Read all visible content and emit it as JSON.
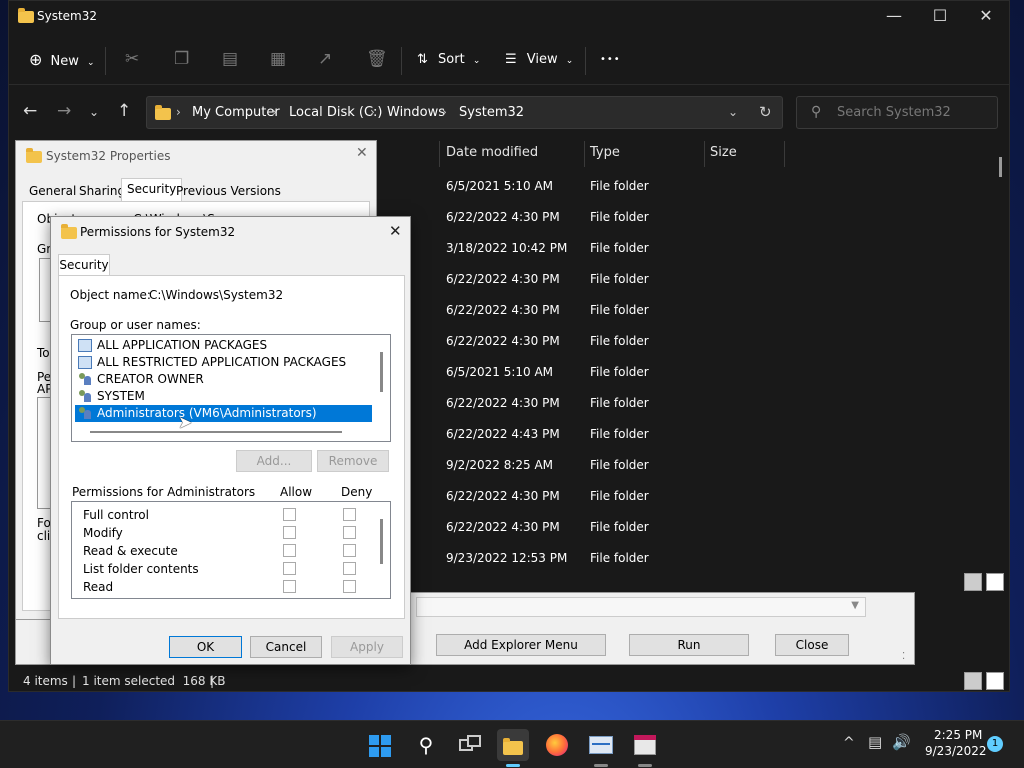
{
  "explorer": {
    "title": "System32",
    "toolbar": {
      "new_label": "New",
      "sort_label": "Sort",
      "view_label": "View",
      "more_label": "•••"
    },
    "breadcrumb": [
      "My Computer",
      "Local Disk (C:)",
      "Windows",
      "System32"
    ],
    "search_placeholder": "Search System32",
    "columns": {
      "date_modified": "Date modified",
      "type": "Type",
      "size": "Size"
    },
    "rows": [
      {
        "date": "6/5/2021 5:10 AM",
        "type": "File folder"
      },
      {
        "date": "6/22/2022 4:30 PM",
        "type": "File folder"
      },
      {
        "date": "3/18/2022 10:42 PM",
        "type": "File folder"
      },
      {
        "date": "6/22/2022 4:30 PM",
        "type": "File folder"
      },
      {
        "date": "6/22/2022 4:30 PM",
        "type": "File folder"
      },
      {
        "date": "6/22/2022 4:30 PM",
        "type": "File folder"
      },
      {
        "date": "6/5/2021 5:10 AM",
        "type": "File folder"
      },
      {
        "date": "6/22/2022 4:30 PM",
        "type": "File folder"
      },
      {
        "date": "6/22/2022 4:43 PM",
        "type": "File folder"
      },
      {
        "date": "9/2/2022 8:25 AM",
        "type": "File folder"
      },
      {
        "date": "6/22/2022 4:30 PM",
        "type": "File folder"
      },
      {
        "date": "6/22/2022 4:30 PM",
        "type": "File folder"
      },
      {
        "date": "9/23/2022 12:53 PM",
        "type": "File folder"
      }
    ],
    "status": {
      "items": "4 items",
      "selected": "1 item selected  168 KB",
      "sep": "|"
    }
  },
  "run_dialog": {
    "add_menu_label": "Add Explorer Menu",
    "run_label": "Run",
    "close_label": "Close"
  },
  "properties": {
    "title": "System32 Properties",
    "tabs": [
      "General",
      "Sharing",
      "Security",
      "Previous Versions"
    ],
    "frag_object": "Object name:    C:\\Windows\\System32",
    "frag_gro": "Gro",
    "frag_to": "To",
    "frag_pe": "Pe",
    "frag_ap": "AP",
    "frag_for": "For",
    "frag_cli": "clic"
  },
  "permissions": {
    "title": "Permissions for System32",
    "tab": "Security",
    "object_label": "Object name:",
    "object_value": "C:\\Windows\\System32",
    "group_label": "Group or user names:",
    "users": [
      {
        "name": "ALL APPLICATION PACKAGES",
        "icon": "package-icon"
      },
      {
        "name": "ALL RESTRICTED APPLICATION PACKAGES",
        "icon": "package-icon"
      },
      {
        "name": "CREATOR OWNER",
        "icon": "user-group-icon"
      },
      {
        "name": "SYSTEM",
        "icon": "user-group-icon"
      },
      {
        "name": "Administrators (VM6\\Administrators)",
        "icon": "user-group-icon",
        "selected": true
      }
    ],
    "add_label": "Add...",
    "remove_label": "Remove",
    "perm_header": "Permissions for Administrators",
    "allow_label": "Allow",
    "deny_label": "Deny",
    "permissions": [
      "Full control",
      "Modify",
      "Read & execute",
      "List folder contents",
      "Read"
    ],
    "ok_label": "OK",
    "cancel_label": "Cancel",
    "apply_label": "Apply"
  },
  "taskbar": {
    "time": "2:25 PM",
    "date": "9/23/2022",
    "notification_count": "1",
    "tray_chevron": "^"
  },
  "colors": {
    "accent": "#0078d7",
    "explorer_bg": "#191919",
    "taskbar_bg": "#202020"
  }
}
